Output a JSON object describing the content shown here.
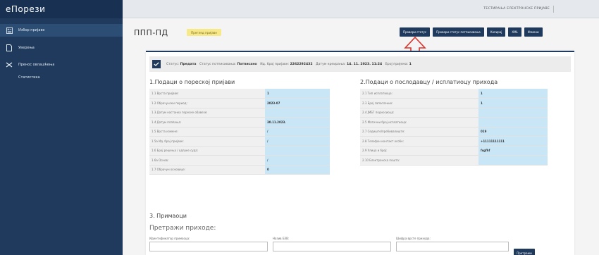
{
  "app": {
    "title": "еПорези"
  },
  "sidebar": {
    "items": [
      {
        "label": "Избор пријаве",
        "icon": "form-icon"
      },
      {
        "label": "Уверења",
        "icon": "document-icon"
      },
      {
        "label": "Пренос овлашћења",
        "icon": "transfer-icon"
      },
      {
        "label": "Статистика",
        "icon": ""
      }
    ]
  },
  "header": {
    "user": "ТЕСТИРАЊА ЕЛЕКТРОНСКЕ ПРИЈАВЕ"
  },
  "page": {
    "title": "ППП-ПД",
    "badge": "Преглед пријаве",
    "buttons": [
      "Провери статус",
      "Провери статус потписивања",
      "Копирај",
      "XML",
      "Измени"
    ]
  },
  "status": {
    "status_label": "Статус:",
    "status_value": "Предата",
    "sign_label": "Статус потписивања:",
    "sign_value": "Потписано",
    "id_label": "Ид. број пријаве:",
    "id_value": "2262292432",
    "created_label": "Датум креирања:",
    "created_value": "14. 11. 2023. 11:24",
    "receipt_label": "Број пријема:",
    "receipt_value": "1"
  },
  "section1": {
    "title": "1.Подаци о пореској пријави",
    "rows": [
      {
        "label": "1.1 Врста пријаве:",
        "value": "1"
      },
      {
        "label": "1.2 Обрачунски период:",
        "value": "2023-07"
      },
      {
        "label": "1.3 Датум настанка пореске обавезе:",
        "value": ""
      },
      {
        "label": "1.4 Датум плаћања:",
        "value": "30.11.2023."
      },
      {
        "label": "1.5 Врста измене:",
        "value": "/"
      },
      {
        "label": "1.5а Ид. број пријаве:",
        "value": "/"
      },
      {
        "label": "1.6 Број решења / одлуке суда:",
        "value": ""
      },
      {
        "label": "1.6а Основ:",
        "value": "/"
      },
      {
        "label": "1.7 Обрачун основице:",
        "value": "0"
      }
    ]
  },
  "section2": {
    "title": "2.Подаци о послодавцу / исплатиоцу прихода",
    "rows": [
      {
        "label": "2.1 Тип исплатиоца:",
        "value": "1"
      },
      {
        "label": "2.3 Број запослених:",
        "value": "1"
      },
      {
        "label": "2.4 ЈМБГ подносиоца:",
        "value": ""
      },
      {
        "label": "2.5 Матични број исплатиоца:",
        "value": ""
      },
      {
        "label": "2.7 Седиште/пребивалиште:",
        "value": "019"
      },
      {
        "label": "2.8 Телефон контакт особе:",
        "value": "+11111111111"
      },
      {
        "label": "2.9 Улица и број:",
        "value": "fsgfhf"
      },
      {
        "label": "2.10 Електронска пошта:",
        "value": ""
      }
    ]
  },
  "section3": {
    "title": "3. Примаоци",
    "search_title": "Претражи приходе:",
    "fields": [
      {
        "label": "Идентификатор примаоца:"
      },
      {
        "label": "Назив БЗВ:"
      },
      {
        "label": "Шифра врсте прихода:"
      }
    ],
    "search_button": "Претражи"
  }
}
